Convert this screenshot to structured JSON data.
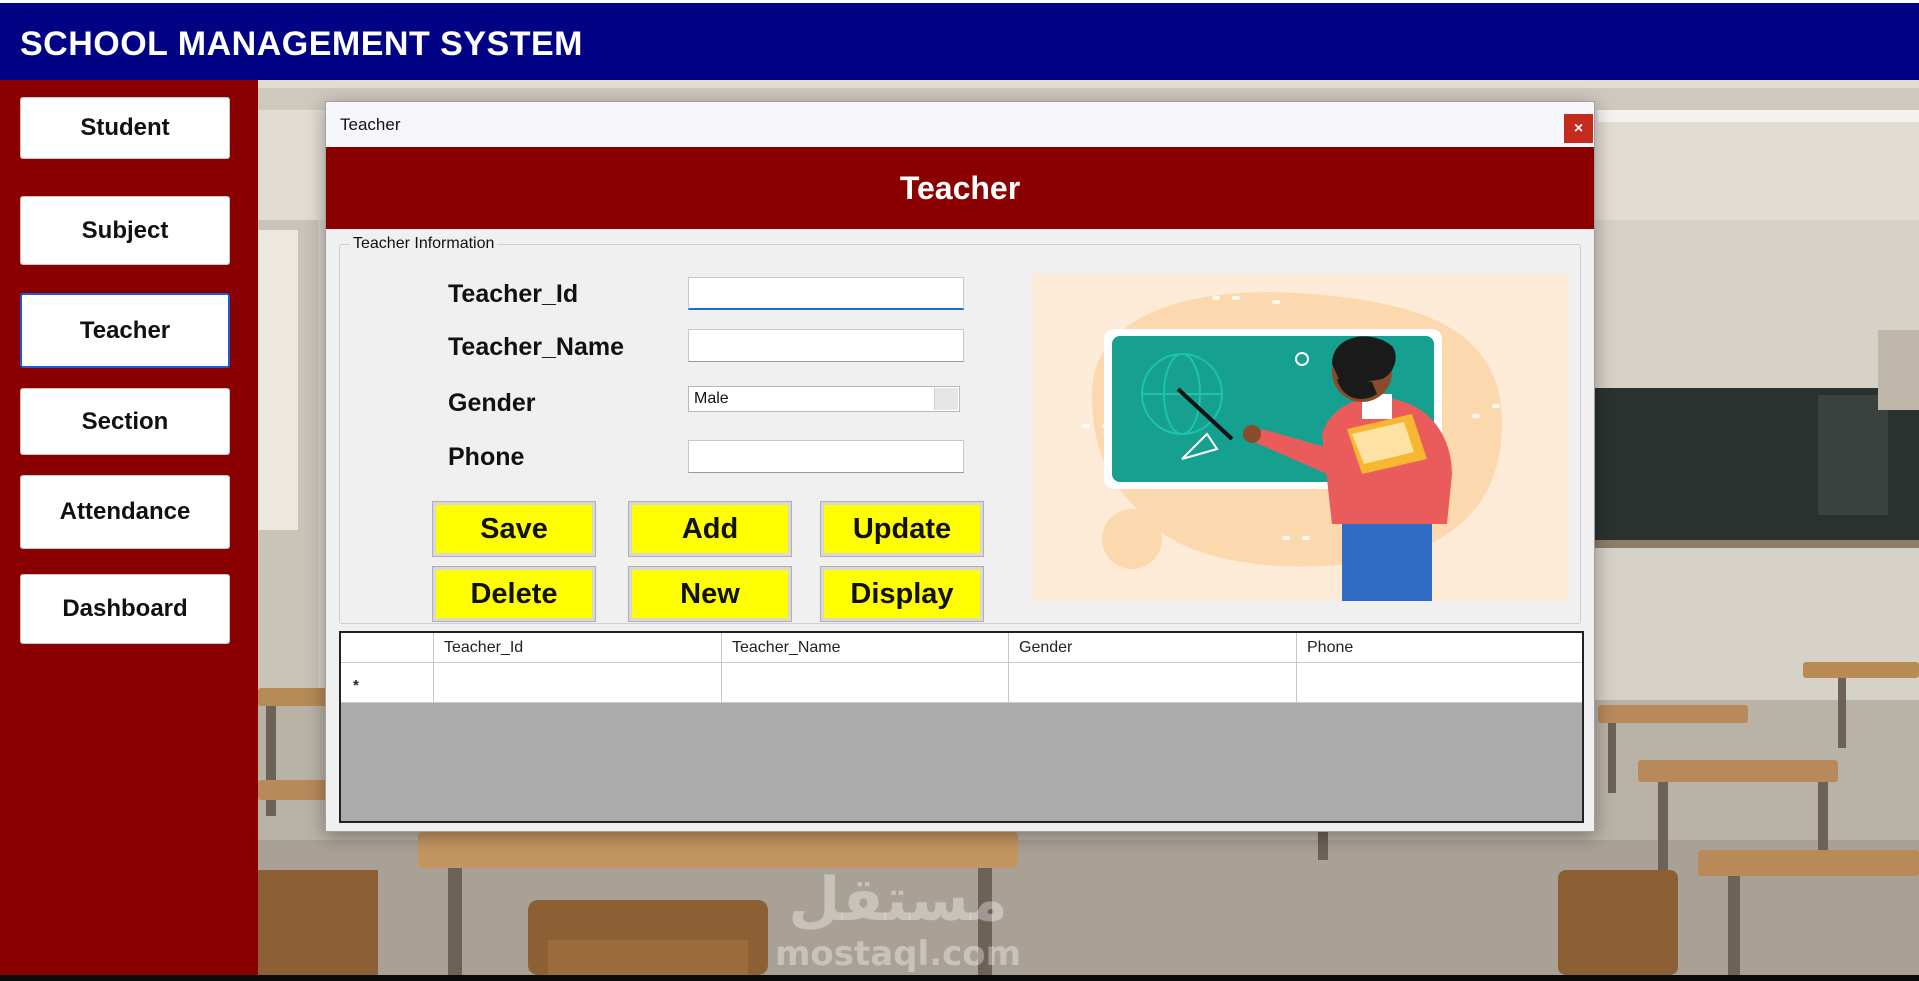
{
  "app": {
    "title": "SCHOOL MANAGEMENT SYSTEM"
  },
  "sidebar": {
    "items": [
      {
        "label": "Student",
        "active": false
      },
      {
        "label": "Subject",
        "active": false
      },
      {
        "label": "Teacher",
        "active": true
      },
      {
        "label": "Section",
        "active": false
      },
      {
        "label": "Attendance",
        "active": false
      },
      {
        "label": "Dashboard",
        "active": false
      }
    ]
  },
  "dialog": {
    "window_title": "Teacher",
    "close_label": "×",
    "header": "Teacher",
    "group_title": "Teacher Information",
    "fields": {
      "teacher_id": {
        "label": "Teacher_Id",
        "value": ""
      },
      "teacher_name": {
        "label": "Teacher_Name",
        "value": ""
      },
      "gender": {
        "label": "Gender",
        "value": "Male"
      },
      "phone": {
        "label": "Phone",
        "value": ""
      }
    },
    "buttons": {
      "save": "Save",
      "add": "Add",
      "update": "Update",
      "delete": "Delete",
      "new": "New",
      "display": "Display"
    },
    "grid": {
      "columns": [
        "Teacher_Id",
        "Teacher_Name",
        "Gender",
        "Phone"
      ],
      "new_row_marker": "*",
      "rows": []
    }
  },
  "watermark": {
    "arabic": "مستقل",
    "latin": "mostaql.com"
  },
  "colors": {
    "title_bar": "#020285",
    "sidebar": "#8a0000",
    "dialog_header": "#8a0000",
    "action_button": "#ffff00",
    "close_button": "#c42b1c"
  }
}
